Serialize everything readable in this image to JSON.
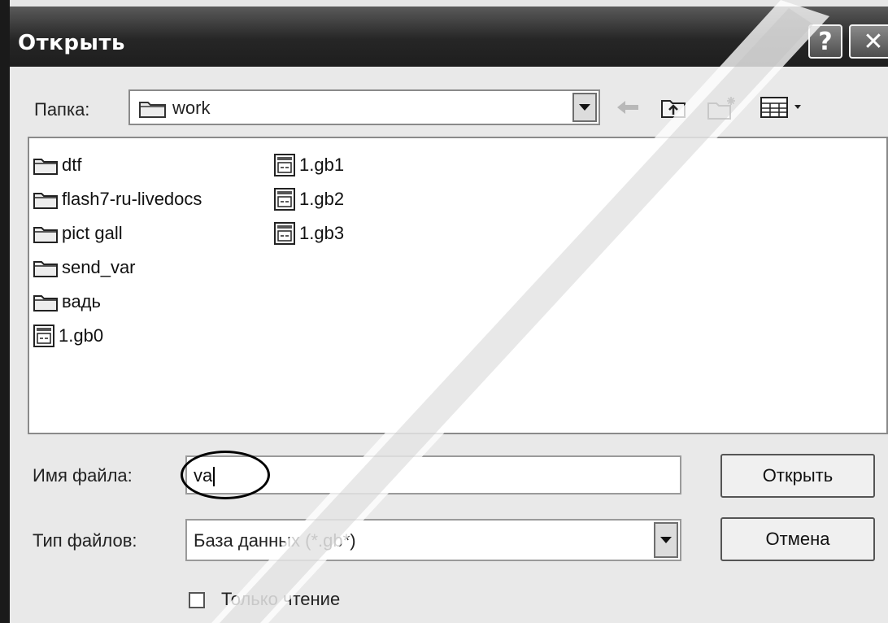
{
  "window": {
    "title": "Открыть",
    "help_glyph": "?",
    "close_glyph": "✕"
  },
  "toolbar": {
    "folder_label": "Папка:",
    "folder_value": "work",
    "icons": [
      "back-arrow-icon",
      "up-folder-icon",
      "new-folder-icon",
      "view-menu-icon"
    ]
  },
  "files": [
    {
      "name": "dtf",
      "kind": "folder"
    },
    {
      "name": "flash7-ru-livedocs",
      "kind": "folder"
    },
    {
      "name": "pict gall",
      "kind": "folder"
    },
    {
      "name": "send_var",
      "kind": "folder"
    },
    {
      "name": "вадь",
      "kind": "folder"
    },
    {
      "name": "1.gb0",
      "kind": "file"
    },
    {
      "name": "1.gb1",
      "kind": "file"
    },
    {
      "name": "1.gb2",
      "kind": "file"
    },
    {
      "name": "1.gb3",
      "kind": "file"
    }
  ],
  "form": {
    "filename_label": "Имя файла:",
    "filename_value": "va",
    "filetype_label": "Тип файлов:",
    "filetype_value": "База данных (*.gb*)",
    "readonly_label": "Только чтение",
    "readonly_checked": false
  },
  "buttons": {
    "open_label": "Открыть",
    "cancel_label": "Отмена"
  }
}
